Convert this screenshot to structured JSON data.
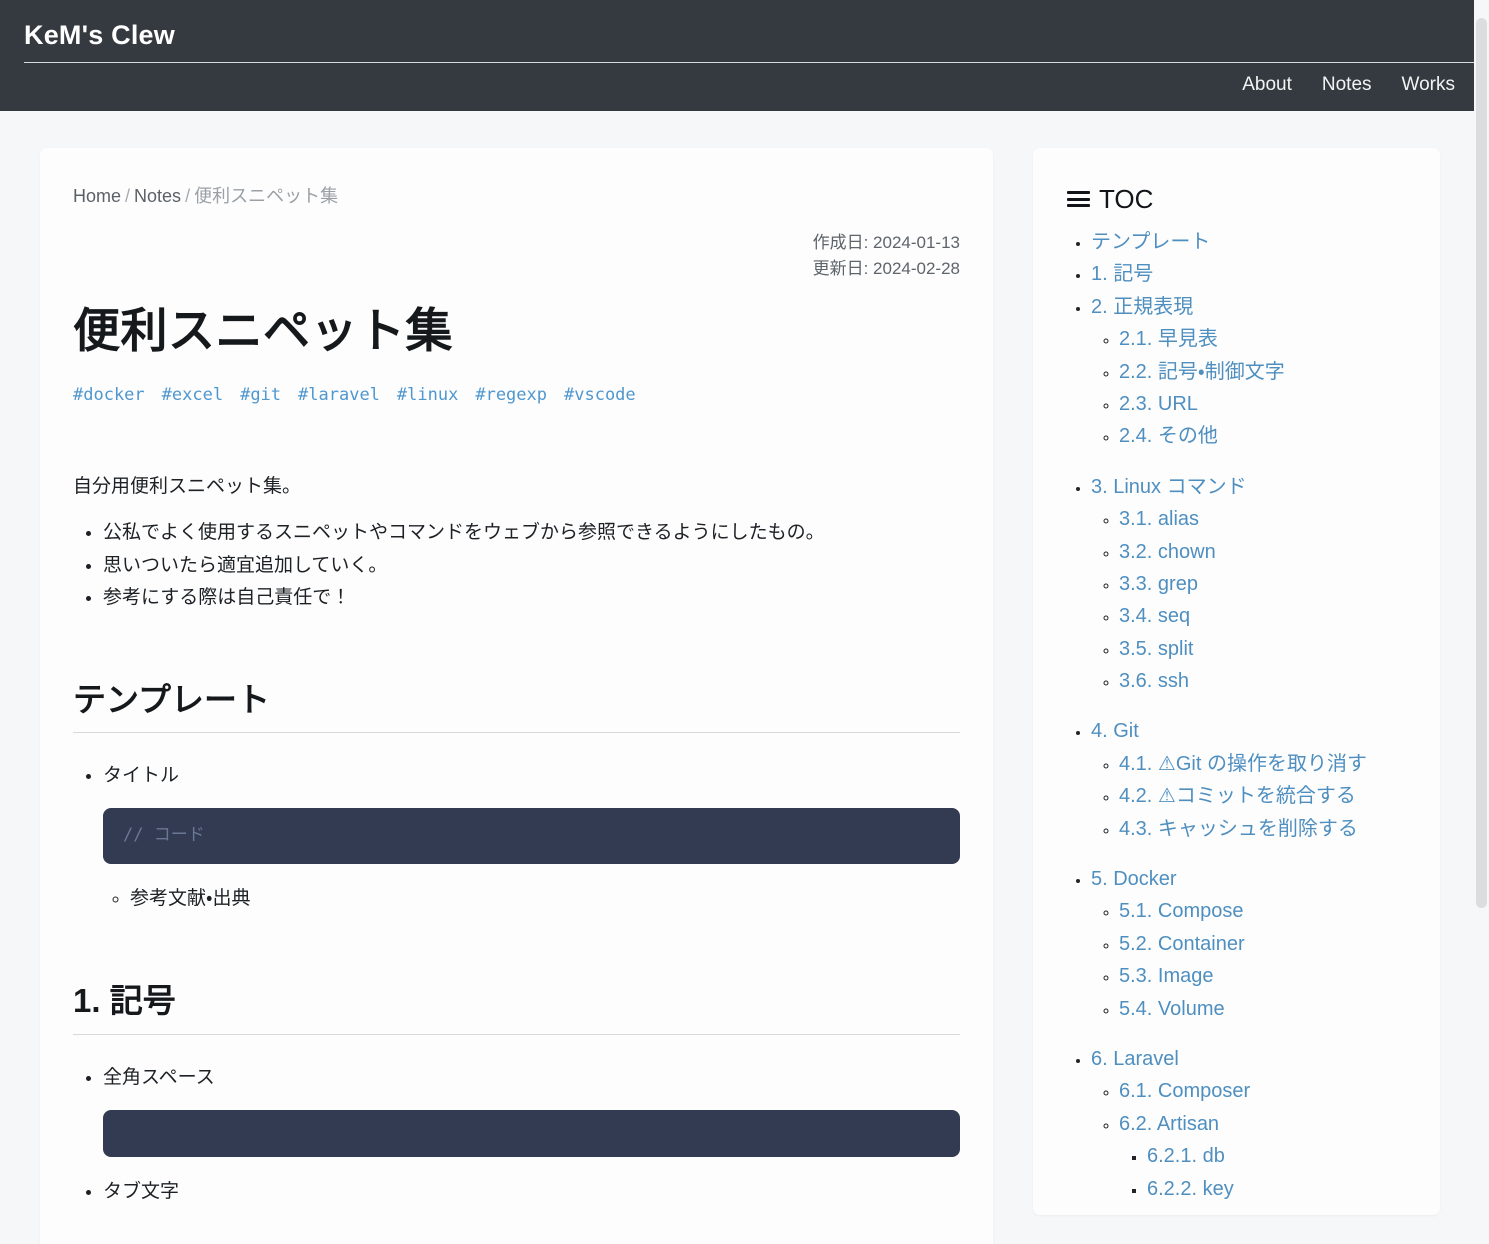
{
  "header": {
    "brand": "KeM's Clew",
    "nav": [
      {
        "label": "About"
      },
      {
        "label": "Notes"
      },
      {
        "label": "Works"
      }
    ]
  },
  "article": {
    "breadcrumb": {
      "home": "Home",
      "section": "Notes",
      "current": "便利スニペット集",
      "separator": "/"
    },
    "dates": {
      "created": "作成日: 2024-01-13",
      "updated": "更新日: 2024-02-28"
    },
    "title": "便利スニペット集",
    "tags": [
      {
        "label": "#docker"
      },
      {
        "label": "#excel"
      },
      {
        "label": "#git"
      },
      {
        "label": "#laravel"
      },
      {
        "label": "#linux"
      },
      {
        "label": "#regexp"
      },
      {
        "label": "#vscode"
      }
    ],
    "lead": "自分用便利スニペット集。",
    "intro_bullets": [
      "公私でよく使用するスニペットやコマンドをウェブから参照できるようにしたもの。",
      "思いついたら適宜追加していく。",
      "参考にする際は自己責任で！"
    ],
    "sections": [
      {
        "heading": "テンプレート",
        "item_label": "タイトル",
        "code": "// コード",
        "sub_item": "参考文献・出典"
      },
      {
        "heading": "1. 記号",
        "item_label": "全角スペース",
        "code": "",
        "next_item": "タブ文字"
      }
    ]
  },
  "toc": {
    "title": "TOC",
    "icon": "hamburger-icon",
    "items": [
      {
        "label": "テンプレート",
        "children": []
      },
      {
        "label": "1. 記号",
        "children": []
      },
      {
        "label": "2. 正規表現",
        "children": [
          {
            "label": "2.1. 早見表"
          },
          {
            "label": "2.2. 記号・制御文字"
          },
          {
            "label": "2.3. URL"
          },
          {
            "label": "2.4. その他"
          }
        ]
      },
      {
        "label": "3. Linux コマンド",
        "spaced": true,
        "children": [
          {
            "label": "3.1. alias"
          },
          {
            "label": "3.2. chown"
          },
          {
            "label": "3.3. grep"
          },
          {
            "label": "3.4. seq"
          },
          {
            "label": "3.5. split"
          },
          {
            "label": "3.6. ssh"
          }
        ]
      },
      {
        "label": "4. Git",
        "spaced": true,
        "children": [
          {
            "label": "4.1. ⚠Git の操作を取り消す"
          },
          {
            "label": "4.2. ⚠コミットを統合する"
          },
          {
            "label": "4.3. キャッシュを削除する"
          }
        ]
      },
      {
        "label": "5. Docker",
        "spaced": true,
        "children": [
          {
            "label": "5.1. Compose"
          },
          {
            "label": "5.2. Container"
          },
          {
            "label": "5.3. Image"
          },
          {
            "label": "5.4. Volume"
          }
        ]
      },
      {
        "label": "6. Laravel",
        "spaced": true,
        "children": [
          {
            "label": "6.1. Composer"
          },
          {
            "label": "6.2. Artisan",
            "children": [
              {
                "label": "6.2.1. db"
              },
              {
                "label": "6.2.2. key"
              }
            ]
          }
        ]
      }
    ]
  },
  "colors": {
    "header_bg": "#343a40",
    "page_bg": "#f6f7f8",
    "card_bg": "#fdfdfd",
    "link": "#4f8fc0",
    "tag": "#4f97cf",
    "code_bg": "#323b52",
    "code_comment": "#6b7794",
    "text": "#1d2125"
  }
}
